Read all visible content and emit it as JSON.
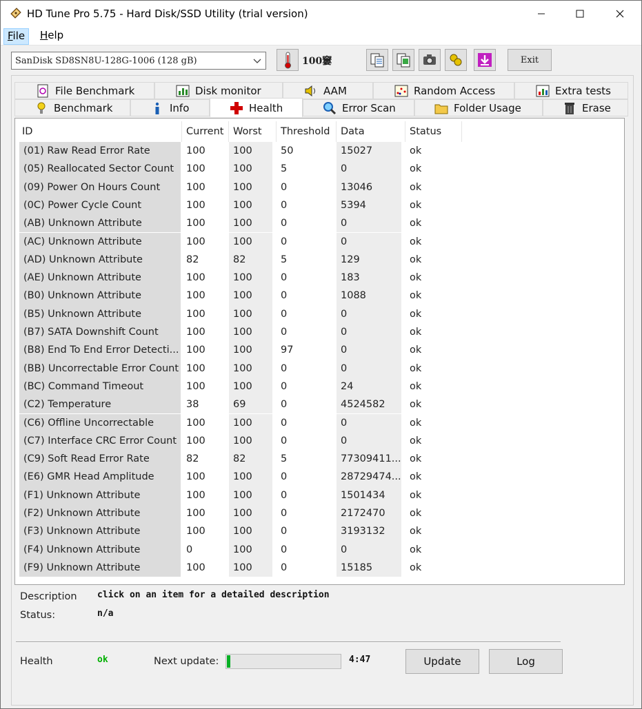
{
  "window": {
    "title": "HD Tune Pro 5.75 - Hard Disk/SSD Utility (trial version)"
  },
  "menu": {
    "file_first": "F",
    "file_rest": "ile",
    "help_first": "H",
    "help_rest": "elp"
  },
  "toolbar": {
    "drive": "SanDisk SD8SN8U-128G-1006 (128 gB)",
    "temperature": "100窶",
    "exit_label": "Exit"
  },
  "tabs": {
    "row1": [
      {
        "label": "File Benchmark",
        "icon": "file-benchmark-icon"
      },
      {
        "label": "Disk monitor",
        "icon": "disk-monitor-icon"
      },
      {
        "label": "AAM",
        "icon": "speaker-icon"
      },
      {
        "label": "Random Access",
        "icon": "random-access-icon"
      },
      {
        "label": "Extra tests",
        "icon": "extra-tests-icon"
      }
    ],
    "row2": [
      {
        "label": "Benchmark",
        "icon": "benchmark-icon"
      },
      {
        "label": "Info",
        "icon": "info-icon"
      },
      {
        "label": "Health",
        "icon": "health-cross-icon"
      },
      {
        "label": "Error Scan",
        "icon": "magnifier-icon"
      },
      {
        "label": "Folder Usage",
        "icon": "folder-icon"
      },
      {
        "label": "Erase",
        "icon": "trash-icon"
      }
    ]
  },
  "table": {
    "columns": [
      "ID",
      "Current",
      "Worst",
      "Threshold",
      "Data",
      "Status"
    ],
    "rows": [
      [
        "(01) Raw Read Error Rate",
        "100",
        "100",
        "50",
        "15027",
        "ok"
      ],
      [
        "(05) Reallocated Sector Count",
        "100",
        "100",
        "5",
        "0",
        "ok"
      ],
      [
        "(09) Power On Hours Count",
        "100",
        "100",
        "0",
        "13046",
        "ok"
      ],
      [
        "(0C) Power Cycle Count",
        "100",
        "100",
        "0",
        "5394",
        "ok"
      ],
      [
        "(AB) Unknown Attribute",
        "100",
        "100",
        "0",
        "0",
        "ok"
      ],
      [
        "(AC) Unknown Attribute",
        "100",
        "100",
        "0",
        "0",
        "ok"
      ],
      [
        "(AD) Unknown Attribute",
        "82",
        "82",
        "5",
        "129",
        "ok"
      ],
      [
        "(AE) Unknown Attribute",
        "100",
        "100",
        "0",
        "183",
        "ok"
      ],
      [
        "(B0) Unknown Attribute",
        "100",
        "100",
        "0",
        "1088",
        "ok"
      ],
      [
        "(B5) Unknown Attribute",
        "100",
        "100",
        "0",
        "0",
        "ok"
      ],
      [
        "(B7) SATA Downshift Count",
        "100",
        "100",
        "0",
        "0",
        "ok"
      ],
      [
        "(B8) End To End Error Detecti...",
        "100",
        "100",
        "97",
        "0",
        "ok"
      ],
      [
        "(BB) Uncorrectable Error Count",
        "100",
        "100",
        "0",
        "0",
        "ok"
      ],
      [
        "(BC) Command Timeout",
        "100",
        "100",
        "0",
        "24",
        "ok"
      ],
      [
        "(C2) Temperature",
        "38",
        "69",
        "0",
        "4524582",
        "ok"
      ],
      [
        "(C6) Offline Uncorrectable",
        "100",
        "100",
        "0",
        "0",
        "ok"
      ],
      [
        "(C7) Interface CRC Error Count",
        "100",
        "100",
        "0",
        "0",
        "ok"
      ],
      [
        "(C9) Soft Read Error Rate",
        "82",
        "82",
        "5",
        "77309411...",
        "ok"
      ],
      [
        "(E6) GMR Head Amplitude",
        "100",
        "100",
        "0",
        "28729474...",
        "ok"
      ],
      [
        "(F1) Unknown Attribute",
        "100",
        "100",
        "0",
        "1501434",
        "ok"
      ],
      [
        "(F2) Unknown Attribute",
        "100",
        "100",
        "0",
        "2172470",
        "ok"
      ],
      [
        "(F3) Unknown Attribute",
        "100",
        "100",
        "0",
        "3193132",
        "ok"
      ],
      [
        "(F4) Unknown Attribute",
        "0",
        "100",
        "0",
        "0",
        "ok"
      ],
      [
        "(F9) Unknown Attribute",
        "100",
        "100",
        "0",
        "15185",
        "ok"
      ]
    ]
  },
  "details": {
    "description_label": "Description",
    "description_value": "click on an item for a detailed description",
    "status_label": "Status:",
    "status_value": "n/a"
  },
  "footer": {
    "health_label": "Health",
    "health_value": "ok",
    "health_color": "#00b000",
    "next_update_label": "Next update:",
    "next_update_time": "4:47",
    "progress_fraction": 0.03,
    "update_label": "Update",
    "log_label": "Log"
  }
}
